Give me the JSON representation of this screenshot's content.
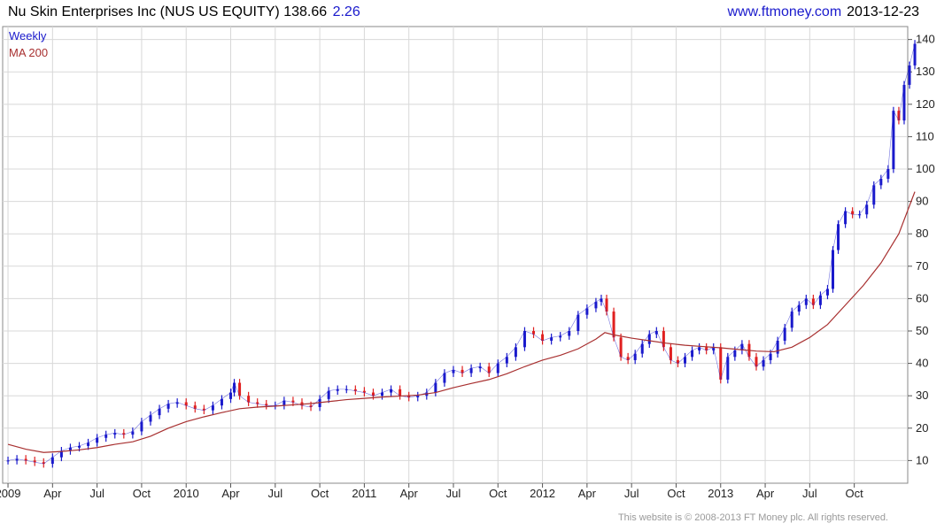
{
  "header": {
    "title": "Nu Skin Enterprises Inc (NUS US EQUITY) 138.66",
    "change": "2.26",
    "source_url": "www.ftmoney.com",
    "date": "2013-12-23"
  },
  "footer": {
    "copyright": "This website is © 2008-2013 FT Money plc. All rights reserved."
  },
  "colors": {
    "up": "#1a1acc",
    "down": "#e02020",
    "ma": "#a83030",
    "grid": "#d8d8d8",
    "frame": "#888888"
  },
  "chart_data": {
    "type": "line",
    "title": "Nu Skin Enterprises Inc (NUS US EQUITY)",
    "legend": [
      "Weekly",
      "MA 200"
    ],
    "legend_position": "top-left",
    "grid": true,
    "y_axis_side": "right",
    "ylim": [
      3,
      144
    ],
    "y_ticks": [
      10,
      20,
      30,
      40,
      50,
      60,
      70,
      80,
      90,
      100,
      110,
      120,
      130,
      140
    ],
    "x_ticks": [
      {
        "label": "2009",
        "t": 2009.0
      },
      {
        "label": "Apr",
        "t": 2009.25
      },
      {
        "label": "Jul",
        "t": 2009.5
      },
      {
        "label": "Oct",
        "t": 2009.75
      },
      {
        "label": "2010",
        "t": 2010.0
      },
      {
        "label": "Apr",
        "t": 2010.25
      },
      {
        "label": "Jul",
        "t": 2010.5
      },
      {
        "label": "Oct",
        "t": 2010.75
      },
      {
        "label": "2011",
        "t": 2011.0
      },
      {
        "label": "Apr",
        "t": 2011.25
      },
      {
        "label": "Jul",
        "t": 2011.5
      },
      {
        "label": "Oct",
        "t": 2011.75
      },
      {
        "label": "2012",
        "t": 2012.0
      },
      {
        "label": "Apr",
        "t": 2012.25
      },
      {
        "label": "Jul",
        "t": 2012.5
      },
      {
        "label": "Oct",
        "t": 2012.75
      },
      {
        "label": "2013",
        "t": 2013.0
      },
      {
        "label": "Apr",
        "t": 2013.25
      },
      {
        "label": "Jul",
        "t": 2013.5
      },
      {
        "label": "Oct",
        "t": 2013.75
      }
    ],
    "xlim": [
      2008.97,
      2014.05
    ],
    "series": [
      {
        "name": "Weekly",
        "points": [
          [
            2009.0,
            10
          ],
          [
            2009.05,
            10.5
          ],
          [
            2009.1,
            10
          ],
          [
            2009.15,
            9.5
          ],
          [
            2009.2,
            9
          ],
          [
            2009.25,
            11
          ],
          [
            2009.3,
            13
          ],
          [
            2009.35,
            14
          ],
          [
            2009.4,
            14.5
          ],
          [
            2009.45,
            15.5
          ],
          [
            2009.5,
            17
          ],
          [
            2009.55,
            18
          ],
          [
            2009.6,
            18.5
          ],
          [
            2009.65,
            18
          ],
          [
            2009.7,
            19
          ],
          [
            2009.75,
            22
          ],
          [
            2009.8,
            24
          ],
          [
            2009.85,
            26
          ],
          [
            2009.9,
            27.5
          ],
          [
            2009.95,
            28
          ],
          [
            2010.0,
            27
          ],
          [
            2010.05,
            26
          ],
          [
            2010.1,
            25.5
          ],
          [
            2010.15,
            27
          ],
          [
            2010.2,
            29
          ],
          [
            2010.25,
            31
          ],
          [
            2010.27,
            34
          ],
          [
            2010.3,
            30
          ],
          [
            2010.35,
            28
          ],
          [
            2010.4,
            27.5
          ],
          [
            2010.45,
            27
          ],
          [
            2010.5,
            27
          ],
          [
            2010.55,
            28.5
          ],
          [
            2010.6,
            28
          ],
          [
            2010.65,
            27
          ],
          [
            2010.7,
            26.5
          ],
          [
            2010.75,
            29
          ],
          [
            2010.8,
            31.5
          ],
          [
            2010.85,
            32
          ],
          [
            2010.9,
            32
          ],
          [
            2010.95,
            31.5
          ],
          [
            2011.0,
            31
          ],
          [
            2011.05,
            30
          ],
          [
            2011.1,
            31
          ],
          [
            2011.15,
            32
          ],
          [
            2011.2,
            30
          ],
          [
            2011.25,
            29.5
          ],
          [
            2011.3,
            30
          ],
          [
            2011.35,
            31
          ],
          [
            2011.4,
            34
          ],
          [
            2011.45,
            37
          ],
          [
            2011.5,
            38
          ],
          [
            2011.55,
            37
          ],
          [
            2011.6,
            38.5
          ],
          [
            2011.65,
            39
          ],
          [
            2011.7,
            37
          ],
          [
            2011.75,
            40
          ],
          [
            2011.8,
            42
          ],
          [
            2011.85,
            45
          ],
          [
            2011.9,
            50
          ],
          [
            2011.95,
            49
          ],
          [
            2012.0,
            47
          ],
          [
            2012.05,
            48
          ],
          [
            2012.1,
            48.5
          ],
          [
            2012.15,
            50
          ],
          [
            2012.2,
            55
          ],
          [
            2012.25,
            57
          ],
          [
            2012.3,
            59
          ],
          [
            2012.33,
            60
          ],
          [
            2012.36,
            56
          ],
          [
            2012.4,
            48
          ],
          [
            2012.44,
            42
          ],
          [
            2012.48,
            41
          ],
          [
            2012.52,
            43
          ],
          [
            2012.56,
            46
          ],
          [
            2012.6,
            49
          ],
          [
            2012.64,
            50
          ],
          [
            2012.68,
            45
          ],
          [
            2012.72,
            41
          ],
          [
            2012.76,
            40
          ],
          [
            2012.8,
            42
          ],
          [
            2012.84,
            44
          ],
          [
            2012.88,
            45
          ],
          [
            2012.92,
            44
          ],
          [
            2012.96,
            45
          ],
          [
            2013.0,
            35
          ],
          [
            2013.04,
            42
          ],
          [
            2013.08,
            44
          ],
          [
            2013.12,
            46
          ],
          [
            2013.16,
            42
          ],
          [
            2013.2,
            39
          ],
          [
            2013.24,
            41
          ],
          [
            2013.28,
            43
          ],
          [
            2013.32,
            47
          ],
          [
            2013.36,
            51
          ],
          [
            2013.4,
            56
          ],
          [
            2013.44,
            58
          ],
          [
            2013.48,
            60
          ],
          [
            2013.52,
            58
          ],
          [
            2013.56,
            61
          ],
          [
            2013.6,
            63
          ],
          [
            2013.63,
            75
          ],
          [
            2013.66,
            83
          ],
          [
            2013.7,
            87
          ],
          [
            2013.74,
            86
          ],
          [
            2013.78,
            86
          ],
          [
            2013.82,
            89
          ],
          [
            2013.86,
            95
          ],
          [
            2013.9,
            97
          ],
          [
            2013.94,
            100
          ],
          [
            2013.97,
            118
          ],
          [
            2014.0,
            115
          ],
          [
            2014.03,
            126
          ],
          [
            2014.06,
            132
          ],
          [
            2014.09,
            138.66
          ]
        ]
      },
      {
        "name": "MA 200",
        "points": [
          [
            2009.0,
            15
          ],
          [
            2009.1,
            13.5
          ],
          [
            2009.2,
            12.5
          ],
          [
            2009.3,
            12.8
          ],
          [
            2009.4,
            13.3
          ],
          [
            2009.5,
            14
          ],
          [
            2009.6,
            15
          ],
          [
            2009.7,
            15.8
          ],
          [
            2009.8,
            17.5
          ],
          [
            2009.9,
            20
          ],
          [
            2010.0,
            22
          ],
          [
            2010.1,
            23.5
          ],
          [
            2010.2,
            24.8
          ],
          [
            2010.3,
            26
          ],
          [
            2010.4,
            26.5
          ],
          [
            2010.5,
            26.8
          ],
          [
            2010.6,
            27.2
          ],
          [
            2010.7,
            27.6
          ],
          [
            2010.8,
            28.2
          ],
          [
            2010.9,
            28.8
          ],
          [
            2011.0,
            29.2
          ],
          [
            2011.1,
            29.6
          ],
          [
            2011.2,
            29.9
          ],
          [
            2011.3,
            30.2
          ],
          [
            2011.4,
            31
          ],
          [
            2011.5,
            32.5
          ],
          [
            2011.6,
            33.8
          ],
          [
            2011.7,
            35
          ],
          [
            2011.8,
            36.8
          ],
          [
            2011.9,
            39
          ],
          [
            2012.0,
            41
          ],
          [
            2012.1,
            42.5
          ],
          [
            2012.2,
            44.5
          ],
          [
            2012.3,
            47.5
          ],
          [
            2012.35,
            49.5
          ],
          [
            2012.4,
            48.8
          ],
          [
            2012.5,
            47.8
          ],
          [
            2012.6,
            47
          ],
          [
            2012.7,
            46.2
          ],
          [
            2012.8,
            45.6
          ],
          [
            2012.9,
            45.2
          ],
          [
            2013.0,
            44.8
          ],
          [
            2013.1,
            44.3
          ],
          [
            2013.2,
            43.8
          ],
          [
            2013.3,
            43.6
          ],
          [
            2013.4,
            45
          ],
          [
            2013.5,
            48
          ],
          [
            2013.6,
            52
          ],
          [
            2013.7,
            58
          ],
          [
            2013.8,
            64
          ],
          [
            2013.9,
            71
          ],
          [
            2014.0,
            80
          ],
          [
            2014.09,
            93
          ]
        ]
      }
    ],
    "last_value": 138.66,
    "last_change": 2.26
  }
}
